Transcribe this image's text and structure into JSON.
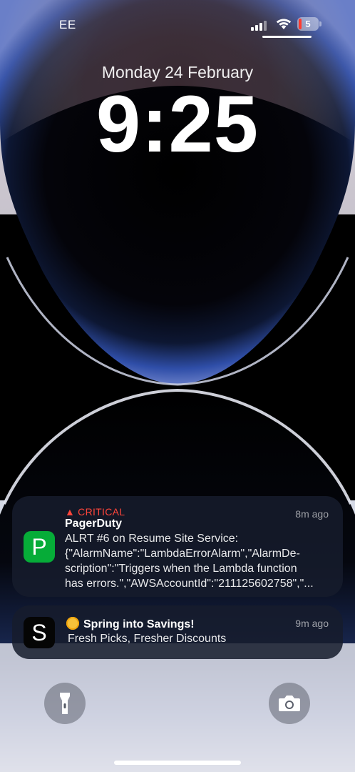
{
  "status_bar": {
    "carrier": "EE",
    "battery_percent": "5",
    "signal_bars": 3,
    "icons": [
      "signal-icon",
      "wifi-icon",
      "battery-icon"
    ]
  },
  "lock_screen": {
    "date": "Monday 24 February",
    "time": "9:25"
  },
  "notifications": [
    {
      "app": "PagerDuty",
      "icon": "pagerduty-icon",
      "icon_letter": "P",
      "icon_color": "#06ac38",
      "priority": "CRITICAL",
      "priority_color": "#ff453a",
      "time": "8m ago",
      "title": "PagerDuty",
      "body_lines": [
        "ALRT #6 on Resume Site Service:",
        "{\"AlarmName\":\"LambdaErrorAlarm\",\"AlarmDe-",
        "scription\":\"Triggers when the Lambda function",
        "has errors.\",\"AWSAccountId\":\"211125602758\",\"..."
      ]
    },
    {
      "app": "S",
      "icon": "s-app-icon",
      "icon_letter": "S",
      "icon_color": "#050505",
      "time": "9m ago",
      "title": "Spring into Savings!",
      "title_icon": "sun-icon",
      "body": "Fresh Picks, Fresher Discounts"
    }
  ],
  "controls": {
    "left": "flashlight-icon",
    "right": "camera-icon"
  }
}
